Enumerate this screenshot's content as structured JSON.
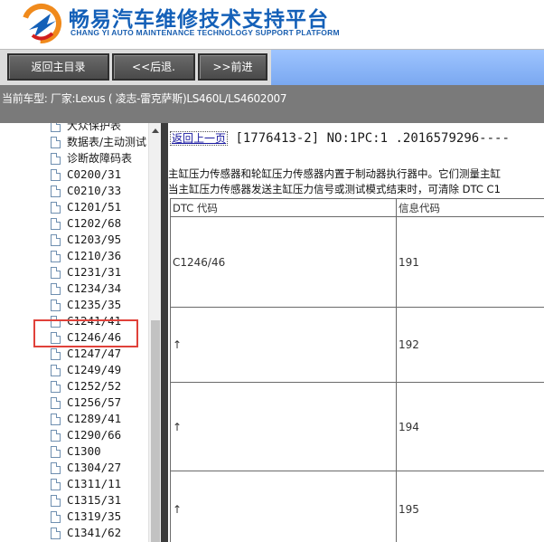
{
  "header": {
    "title_cn": "畅易汽车维修技术支持平台",
    "title_en": "CHANG YI AUTO MAINTENANCE TECHNOLOGY SUPPORT PLATFORM",
    "brand_color": "#1460b8"
  },
  "nav": {
    "home_label": "返回主目录",
    "back_label": "<<后退.",
    "forward_label": ">>前进"
  },
  "vehicle": {
    "text": "当前车型:  厂家:Lexus ( 凌志-雷克萨斯)LS460L/LS4602007"
  },
  "tree": {
    "items": [
      {
        "label": "大众保护表",
        "cn": true
      },
      {
        "label": "数据表/主动测试",
        "cn": true
      },
      {
        "label": "诊断故障码表",
        "cn": true
      },
      {
        "label": "C0200/31"
      },
      {
        "label": "C0210/33"
      },
      {
        "label": "C1201/51"
      },
      {
        "label": "C1202/68"
      },
      {
        "label": "C1203/95"
      },
      {
        "label": "C1210/36"
      },
      {
        "label": "C1231/31"
      },
      {
        "label": "C1234/34"
      },
      {
        "label": "C1235/35"
      },
      {
        "label": "C1241/41"
      },
      {
        "label": "C1246/46",
        "selected": true
      },
      {
        "label": "C1247/47"
      },
      {
        "label": "C1249/49"
      },
      {
        "label": "C1252/52"
      },
      {
        "label": "C1256/57"
      },
      {
        "label": "C1289/41"
      },
      {
        "label": "C1290/66"
      },
      {
        "label": "C1300"
      },
      {
        "label": "C1304/27"
      },
      {
        "label": "C1311/11"
      },
      {
        "label": "C1315/31"
      },
      {
        "label": "C1319/35"
      },
      {
        "label": "C1341/62"
      }
    ]
  },
  "content": {
    "back_link": "返回上一页",
    "doc_id": "[1776413-2] NO:1PC:1 .2016579296----",
    "desc_line1": "主缸压力传感器和轮缸压力传感器内置于制动器执行器中。它们测量主缸",
    "desc_line2": "当主缸压力传感器发送主缸压力信号或测试模式结束时，可清除 DTC C1",
    "table": {
      "col1_header": "DTC 代码",
      "col2_header": "信息代码",
      "rows": [
        {
          "dtc": "C1246/46",
          "info": "191"
        },
        {
          "dtc": "↑",
          "info": "192"
        },
        {
          "dtc": "↑",
          "info": "194"
        },
        {
          "dtc": "↑",
          "info": "195"
        }
      ]
    }
  }
}
